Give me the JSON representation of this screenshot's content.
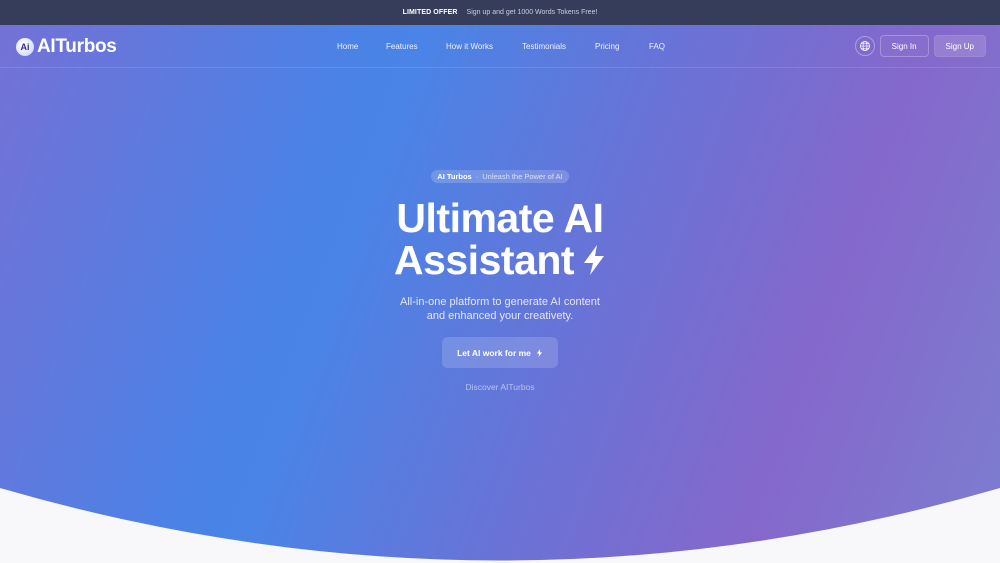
{
  "promo": {
    "tag": "LIMITED OFFER",
    "text": "Sign up and get 1000 Words Tokens Free!"
  },
  "header": {
    "logo_badge": "Ai",
    "logo_text": "AITurbos",
    "nav": [
      {
        "label": "Home"
      },
      {
        "label": "Features"
      },
      {
        "label": "How it Works"
      },
      {
        "label": "Testimonials"
      },
      {
        "label": "Pricing"
      },
      {
        "label": "FAQ"
      }
    ],
    "language_icon": "globe-icon",
    "signin_label": "Sign In",
    "signup_label": "Sign Up"
  },
  "hero": {
    "pill_strong": "AI Turbos",
    "pill_separator": "·",
    "pill_sub": "Unleash the Power of AI",
    "headline_line1": "Ultimate AI",
    "headline_line2": "Assistant",
    "headline_icon": "lightning-bolt-icon",
    "subtitle_line1": "All-in-one platform to generate AI content",
    "subtitle_line2": "and enhanced your creativety.",
    "cta_label": "Let AI work for me",
    "cta_icon": "sparkle-icon",
    "discover_label": "Discover AITurbos"
  },
  "colors": {
    "promo_bg": "#363d5a",
    "gradient_blue": "#4a84e6",
    "gradient_purple": "#8568cb",
    "page_bg": "#f8f8fb"
  }
}
